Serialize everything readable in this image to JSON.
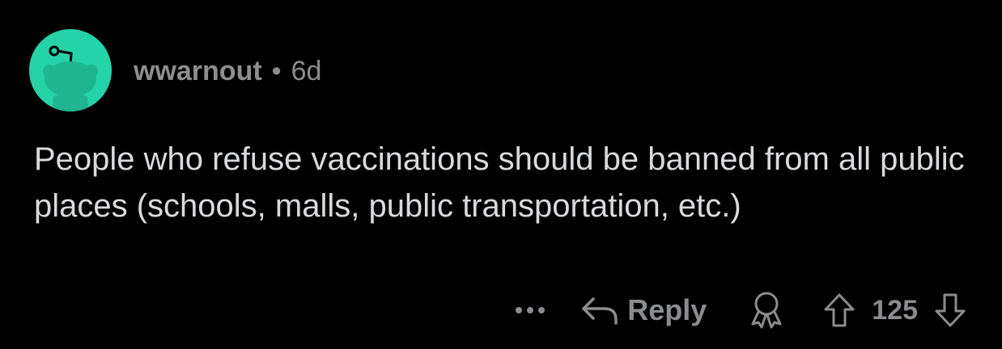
{
  "comment": {
    "author": "wwarnout",
    "separator": "•",
    "age": "6d",
    "body": "People who refuse vaccinations should be banned from all public places (schools, malls, public transportation, etc.)",
    "score": "125",
    "reply_label": "Reply"
  },
  "colors": {
    "background": "#000000",
    "avatar": "#24d3a7",
    "meta_text": "#8c8c8c",
    "body_text": "#d8dadc",
    "action_text": "#8a8c8e"
  },
  "icons": {
    "avatar": "snoo-avatar-icon",
    "more": "more-options-icon",
    "reply": "reply-arrow-icon",
    "award": "award-icon",
    "upvote": "upvote-arrow-icon",
    "downvote": "downvote-arrow-icon"
  }
}
